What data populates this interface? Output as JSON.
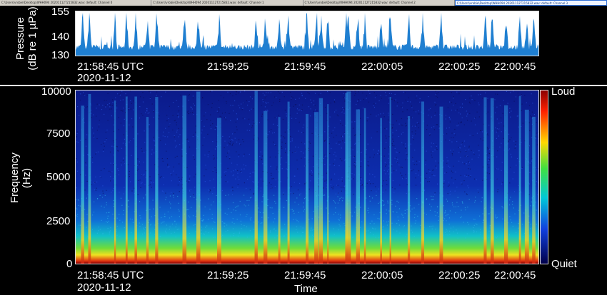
{
  "tabs": [
    {
      "label": "C:\\Users\\vrobie\\Desktop\\WHH094 20201112T215832.wav: default: Channel 0"
    },
    {
      "label": "C:\\Users\\vrobie\\Desktop\\WHH094 20201112T215832.wav: default: Channel 1"
    },
    {
      "label": "C:\\Users\\vrobie\\Desktop\\WHH094 20201112T215832.wav: default: Channel 2"
    },
    {
      "label": "C:\\Users\\vrobie\\Desktop\\WHH094 20201112T215832.wav: default: Channel 3",
      "active": true
    }
  ],
  "waveform": {
    "ylabel_line1": "Pressure",
    "ylabel_line2": "(dB re 1 µPa)",
    "y_ticks": [
      "155",
      "140",
      "130"
    ],
    "ylim": [
      130,
      155
    ],
    "color": "#1f7fd1",
    "x_ticks": [
      "21:58:45 UTC",
      "21:59:25",
      "21:59:45",
      "22:00:05",
      "22:00:25",
      "22:00:45"
    ],
    "date": "2020-11-12"
  },
  "spectrogram": {
    "ylabel_line1": "Frequency",
    "ylabel_line2": "(Hz)",
    "y_ticks": [
      "10000",
      "7500",
      "5000",
      "2500",
      "0"
    ],
    "ylim": [
      0,
      10000
    ],
    "x_ticks": [
      "21:58:45 UTC",
      "21:59:25",
      "21:59:45",
      "22:00:05",
      "22:00:25",
      "22:00:45"
    ],
    "date": "2020-11-12",
    "xlabel": "Time",
    "colorbar_top": "Loud",
    "colorbar_bottom": "Quiet"
  }
}
